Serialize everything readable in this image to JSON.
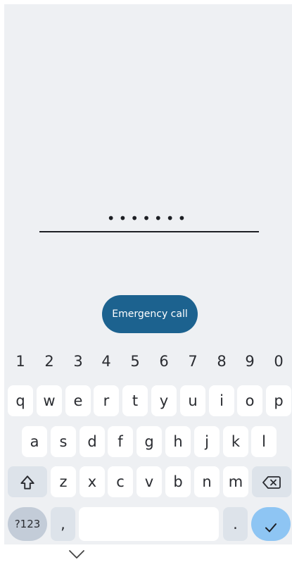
{
  "lock": {
    "pin_mask": "•••••••",
    "emergency_label": "Emergency call"
  },
  "keyboard": {
    "number_row": [
      "1",
      "2",
      "3",
      "4",
      "5",
      "6",
      "7",
      "8",
      "9",
      "0"
    ],
    "row1": [
      "q",
      "w",
      "e",
      "r",
      "t",
      "y",
      "u",
      "i",
      "o",
      "p"
    ],
    "row2": [
      "a",
      "s",
      "d",
      "f",
      "g",
      "h",
      "j",
      "k",
      "l"
    ],
    "row3": [
      "z",
      "x",
      "c",
      "v",
      "b",
      "n",
      "m"
    ],
    "symbols_label": "?123",
    "comma_label": ",",
    "period_label": ".",
    "icons": {
      "shift": "shift-icon",
      "backspace": "backspace-icon",
      "enter": "checkmark-icon",
      "nav": "chevron-down-icon"
    }
  },
  "colors": {
    "emergency_button": "#1c628f",
    "enter_key": "#8ec5f3",
    "keyboard_bg": "#eef0f3",
    "dark_key": "#dde3ea"
  }
}
